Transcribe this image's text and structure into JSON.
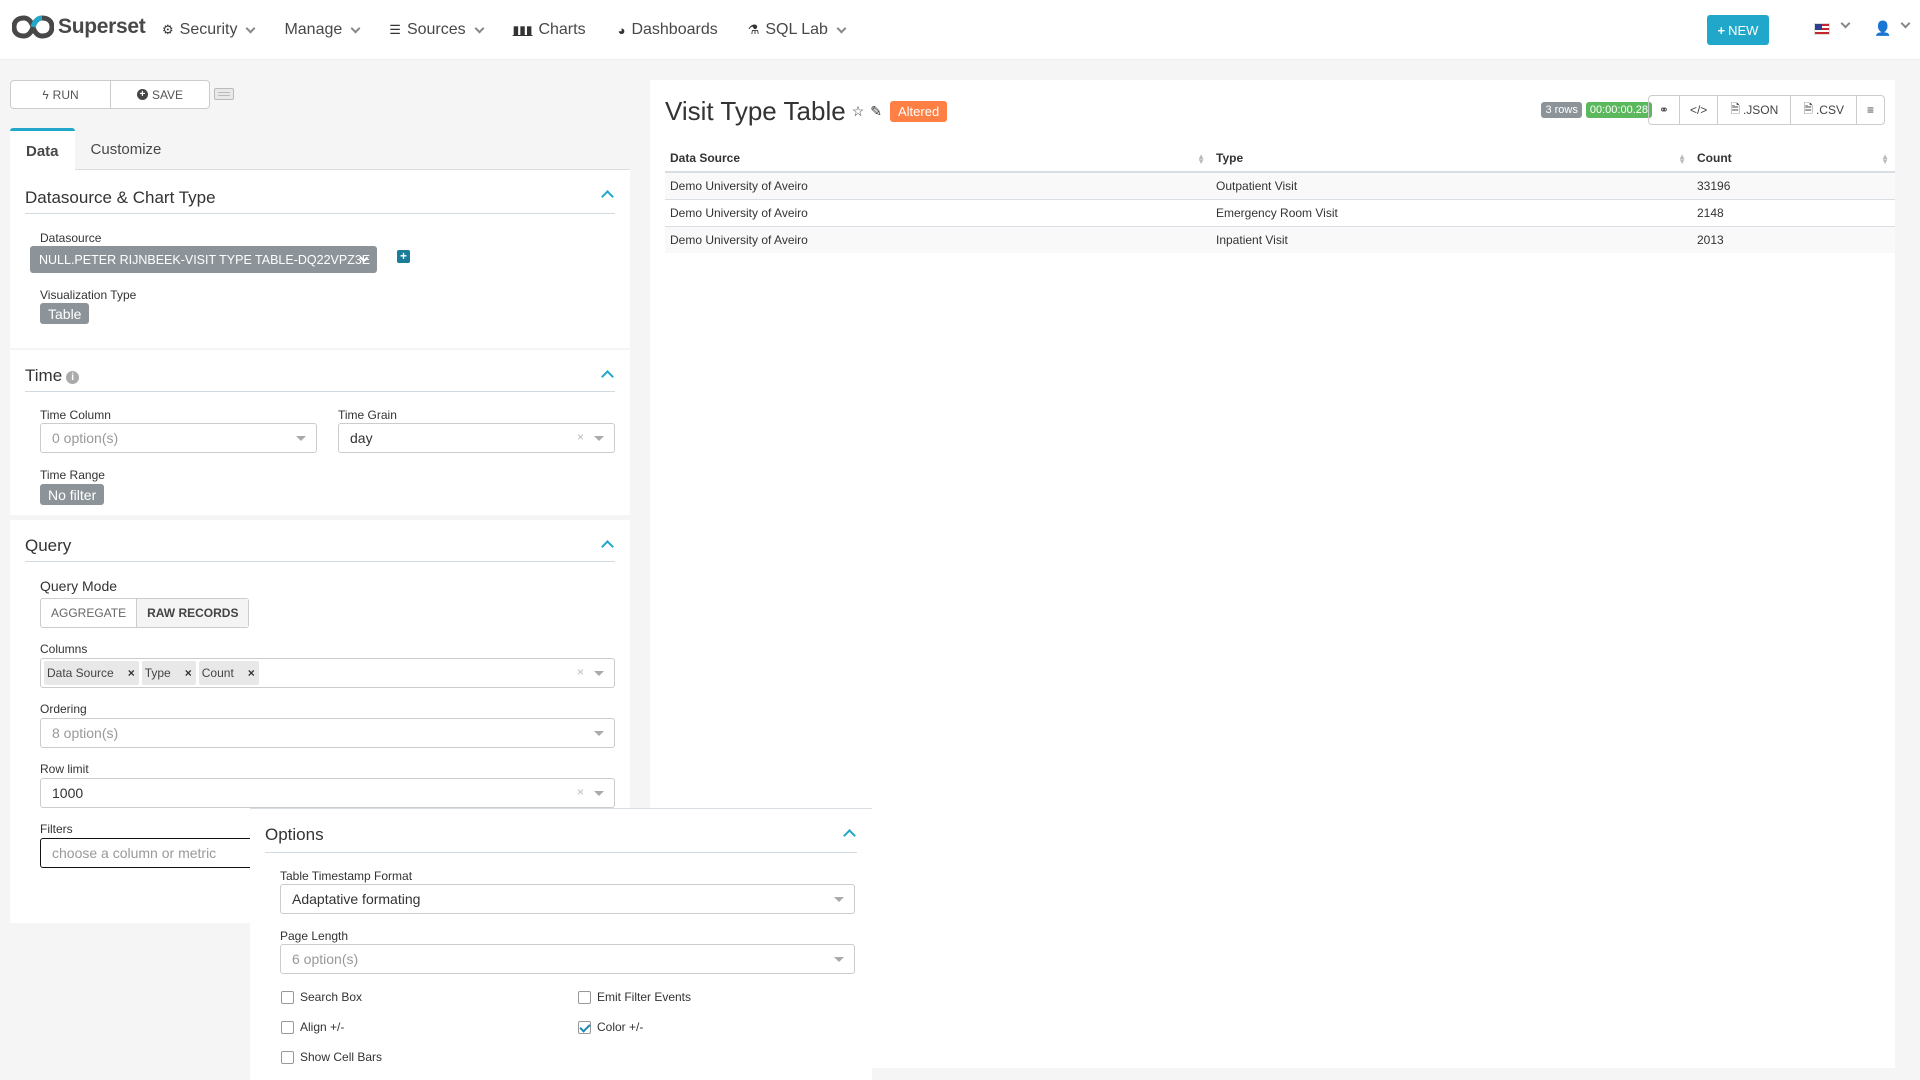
{
  "navbar": {
    "brand": "Superset",
    "items": [
      {
        "label": "Security",
        "icon": "cogs-icon",
        "has_dropdown": true
      },
      {
        "label": "Manage",
        "icon": null,
        "has_dropdown": true
      },
      {
        "label": "Sources",
        "icon": "database-icon",
        "has_dropdown": true
      },
      {
        "label": "Charts",
        "icon": "bar-chart-icon",
        "has_dropdown": false
      },
      {
        "label": "Dashboards",
        "icon": "dashboard-icon",
        "has_dropdown": false
      },
      {
        "label": "SQL Lab",
        "icon": "flask-icon",
        "has_dropdown": true
      }
    ],
    "new_button": "NEW",
    "language_icon": "us-flag-icon",
    "user_icon": "user-icon"
  },
  "toolbar": {
    "run_label": "RUN",
    "save_label": "SAVE"
  },
  "tabs": [
    {
      "label": "Data",
      "active": true
    },
    {
      "label": "Customize",
      "active": false
    }
  ],
  "sections": {
    "datasource": {
      "title": "Datasource & Chart Type",
      "datasource_label": "Datasource",
      "datasource_value": "NULL.PETER RIJNBEEK-VISIT TYPE TABLE-DQ22VPZ3E",
      "viz_label": "Visualization Type",
      "viz_value": "Table"
    },
    "time": {
      "title": "Time",
      "time_column_label": "Time Column",
      "time_column_placeholder": "0 option(s)",
      "time_grain_label": "Time Grain",
      "time_grain_value": "day",
      "time_range_label": "Time Range",
      "time_range_value": "No filter"
    },
    "query": {
      "title": "Query",
      "query_mode_label": "Query Mode",
      "query_modes": [
        {
          "label": "AGGREGATE",
          "active": false
        },
        {
          "label": "RAW RECORDS",
          "active": true
        }
      ],
      "columns_label": "Columns",
      "columns": [
        "Data Source",
        "Type",
        "Count"
      ],
      "ordering_label": "Ordering",
      "ordering_placeholder": "8 option(s)",
      "row_limit_label": "Row limit",
      "row_limit_value": "1000",
      "filters_label": "Filters",
      "filters_placeholder": "choose a column or metric"
    },
    "options": {
      "title": "Options",
      "timestamp_format_label": "Table Timestamp Format",
      "timestamp_format_value": "Adaptative formating",
      "page_length_label": "Page Length",
      "page_length_placeholder": "6 option(s)",
      "checkboxes": [
        {
          "label": "Search Box",
          "checked": false
        },
        {
          "label": "Emit Filter Events",
          "checked": false
        },
        {
          "label": "Align +/-",
          "checked": false
        },
        {
          "label": "Color +/-",
          "checked": true
        },
        {
          "label": "Show Cell Bars",
          "checked": false
        }
      ]
    }
  },
  "chart": {
    "title": "Visit Type Table",
    "altered_label": "Altered",
    "row_count": "3 rows",
    "query_time": "00:00:00.28",
    "actions": [
      {
        "label": "",
        "icon": "link-icon"
      },
      {
        "label": "",
        "icon": "code-icon"
      },
      {
        "label": ".JSON",
        "icon": "json-file-icon"
      },
      {
        "label": ".CSV",
        "icon": "csv-file-icon"
      },
      {
        "label": "",
        "icon": "menu-icon"
      }
    ],
    "table": {
      "columns": [
        "Data Source",
        "Type",
        "Count"
      ],
      "rows": [
        [
          "Demo University of Aveiro",
          "Outpatient Visit",
          "33196"
        ],
        [
          "Demo University of Aveiro",
          "Emergency Room Visit",
          "2148"
        ],
        [
          "Demo University of Aveiro",
          "Inpatient Visit",
          "2013"
        ]
      ]
    }
  },
  "colors": {
    "accent": "#20a7c9",
    "altered": "#ff7f44",
    "rows_badge": "#8c949a",
    "time_badge": "#5cb85c"
  }
}
